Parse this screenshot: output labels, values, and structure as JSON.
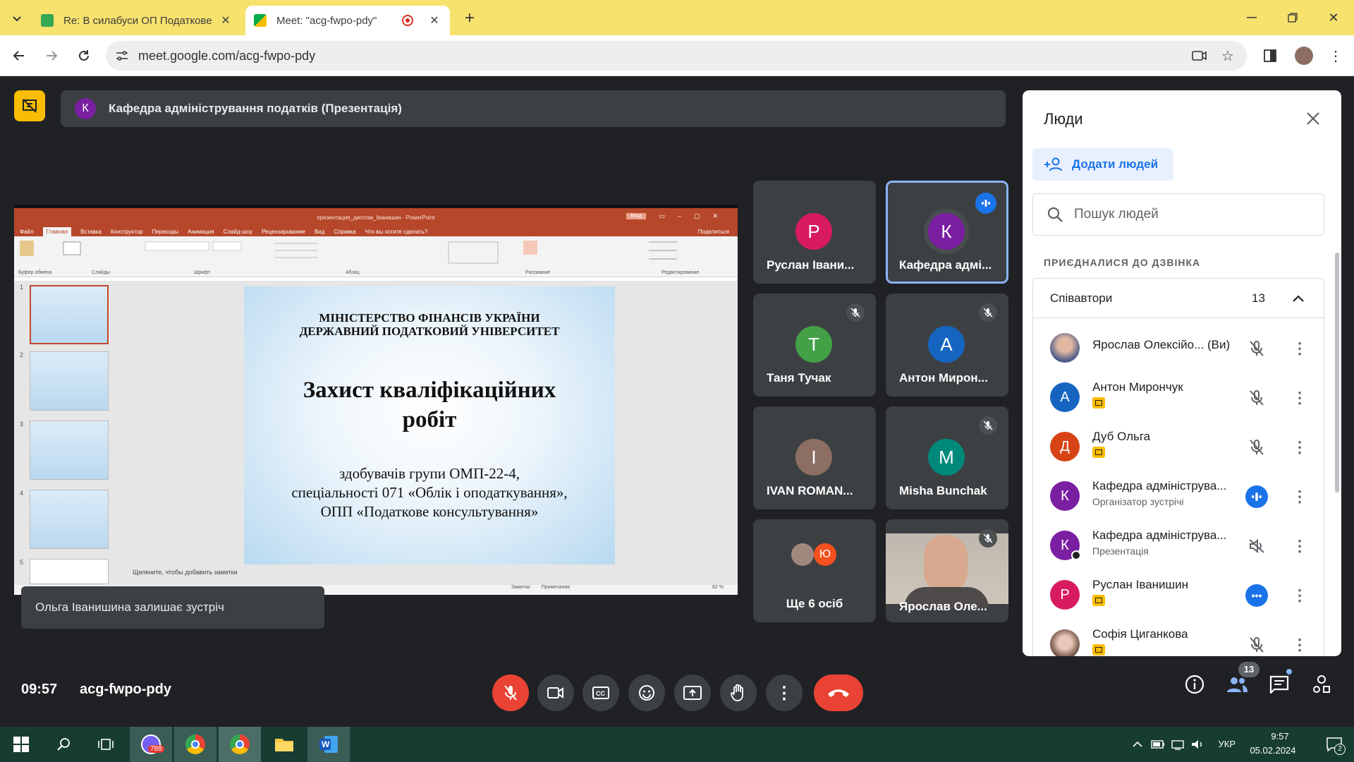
{
  "browser": {
    "tabs": [
      {
        "label": "Re: В силабуси ОП Податкове ко",
        "active": false
      },
      {
        "label": "Meet: \"acg-fwpo-pdy\"",
        "active": true
      }
    ],
    "url": "meet.google.com/acg-fwpo-pdy"
  },
  "meet": {
    "presentation_bar": {
      "avatar_letter": "К",
      "title": "Кафедра адміністрування податків (Презентація)"
    },
    "powerpoint": {
      "title": "презентация_диплом_Іванишин - PowerPoint",
      "login": "Вход",
      "menu": [
        "Файл",
        "Главная",
        "Вставка",
        "Конструктор",
        "Переходы",
        "Анимация",
        "Слайд-шоу",
        "Рецензирование",
        "Вид",
        "Справка",
        "Что вы хотите сделать?"
      ],
      "share": "Поделиться",
      "ribbon_groups": [
        "Буфер обмена",
        "Слайды",
        "Шрифт",
        "Абзац",
        "Рисование",
        "Редактирование"
      ],
      "slide": {
        "line1": "МІНІСТЕРСТВО ФІНАНСІВ УКРАЇНИ",
        "line2": "ДЕРЖАВНИЙ ПОДАТКОВИЙ УНІВЕРСИТЕТ",
        "title1": "Захист кваліфікаційних",
        "title2": "робіт",
        "sub1": "здобувачів групи ОМП-22-4,",
        "sub2": "спеціальності 071 «Облік і оподаткування»,",
        "sub3": "ОПП «Податкове консультування»"
      },
      "notes_placeholder": "Щелкните, чтобы добавить заметки",
      "thumb_numbers": [
        "1",
        "2",
        "3",
        "4",
        "5"
      ],
      "status_notes": "Заметки",
      "status_comments": "Примечания",
      "zoom": "82 %"
    },
    "toast": "Ольга Іванишина залишає зустріч",
    "tiles": [
      {
        "name": "Руслан Івани...",
        "letter": "Р",
        "color": "#d81b60",
        "muted": false
      },
      {
        "name": "Кафедра адмі...",
        "letter": "К",
        "color": "#7b1fa2",
        "muted": false,
        "speaking": true
      },
      {
        "name": "Таня Тучак",
        "letter": "Т",
        "color": "#43a047",
        "muted": true
      },
      {
        "name": "Антон Мирон...",
        "letter": "А",
        "color": "#1565c0",
        "muted": true
      },
      {
        "name": "IVAN ROMAN...",
        "letter": "I",
        "color": "#8d6e63",
        "muted": false
      },
      {
        "name": "Misha Bunchak",
        "letter": "M",
        "color": "#00897b",
        "muted": true
      },
      {
        "name": "Ще 6 осіб",
        "letter": "Ю",
        "color": "#f4511e",
        "muted": false
      },
      {
        "name": "Ярослав Оле...",
        "letter": "",
        "color": "#9e9e9e",
        "muted": true
      }
    ],
    "people": {
      "title": "Люди",
      "add_label": "Додати людей",
      "search_placeholder": "Пошук людей",
      "joined_label": "ПРИЄДНАЛИСЯ ДО ДЗВІНКА",
      "group_label": "Співавтори",
      "group_count": "13",
      "list": [
        {
          "name": "Ярослав Олексійо... (Ви)",
          "sub": "",
          "letter": "",
          "color": "#795548",
          "mic": "muted",
          "presenting": false
        },
        {
          "name": "Антон Мирончук",
          "sub": "",
          "letter": "А",
          "color": "#1565c0",
          "mic": "muted",
          "presenting": true
        },
        {
          "name": "Дуб Ольга",
          "sub": "",
          "letter": "Д",
          "color": "#d84315",
          "mic": "muted",
          "presenting": true
        },
        {
          "name": "Кафедра адмініструва...",
          "sub": "Організатор зустрічі",
          "letter": "К",
          "color": "#7b1fa2",
          "mic": "speaking",
          "presenting": false
        },
        {
          "name": "Кафедра адмініструва...",
          "sub": "Презентація",
          "letter": "К",
          "color": "#7b1fa2",
          "mic": "off",
          "presenting": false
        },
        {
          "name": "Руслан Іванишин",
          "sub": "",
          "letter": "Р",
          "color": "#d81b60",
          "mic": "more",
          "presenting": true
        },
        {
          "name": "Софія Циганкова",
          "sub": "",
          "letter": "",
          "color": "#a1887f",
          "mic": "muted",
          "presenting": true
        }
      ]
    },
    "bottom": {
      "time": "09:57",
      "meeting_code": "acg-fwpo-pdy",
      "participants_badge": "13"
    }
  },
  "taskbar": {
    "viber_badge": "788",
    "lang": "УКР",
    "time": "9:57",
    "date": "05.02.2024",
    "notif_badge": "2"
  },
  "colors": {
    "tabbar": "#f7e26e",
    "meet_bg": "#202124",
    "end_call": "#ea4335",
    "accent_blue": "#1a73e8",
    "taskbar": "#173d33",
    "powerpoint": "#b7472a"
  }
}
